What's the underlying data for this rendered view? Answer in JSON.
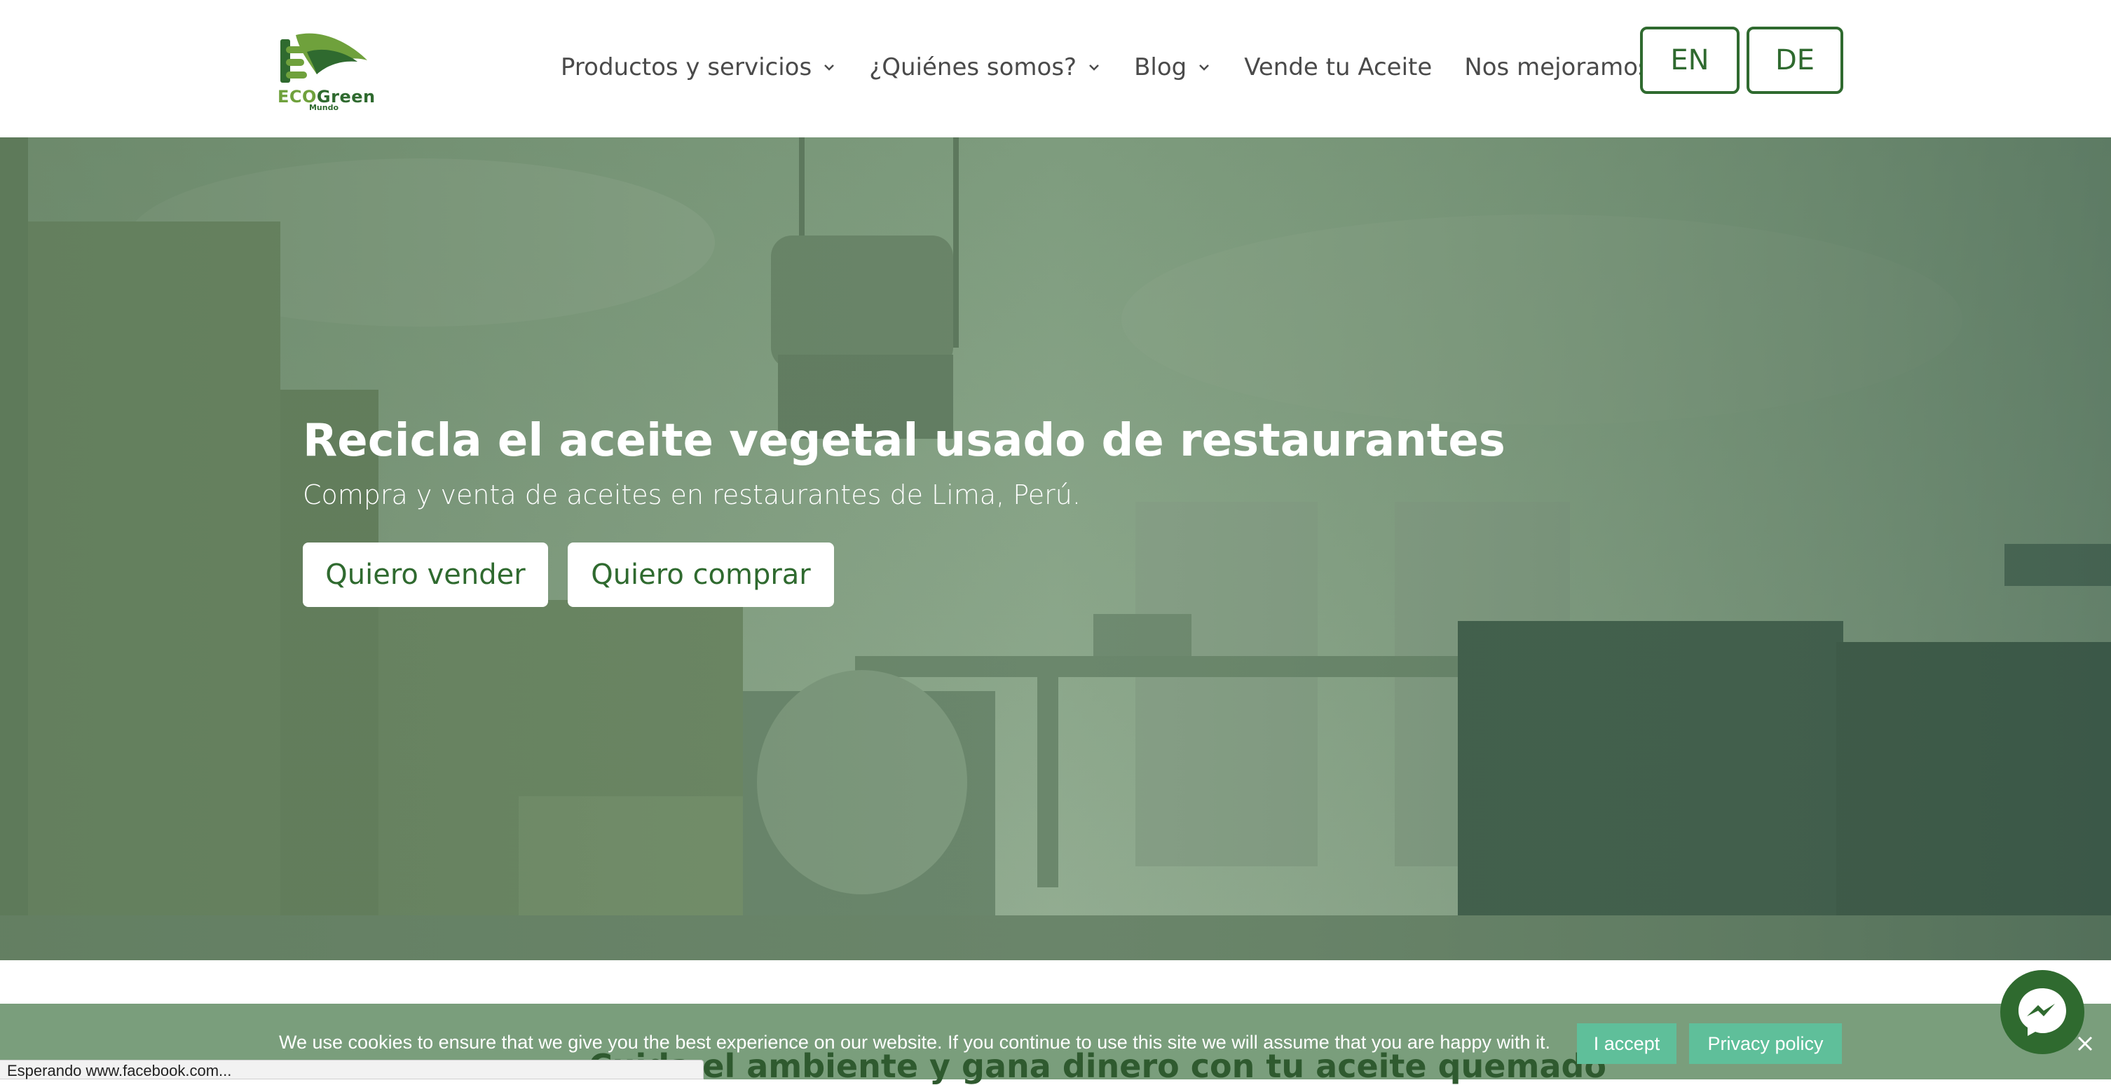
{
  "header": {
    "logo": {
      "eco": "ECO",
      "green": "Green",
      "sub": "Mundo"
    },
    "nav": [
      {
        "label": "Productos y servicios",
        "has_dropdown": true
      },
      {
        "label": "¿Quiénes somos?",
        "has_dropdown": true
      },
      {
        "label": "Blog",
        "has_dropdown": true
      },
      {
        "label": "Vende tu Aceite",
        "has_dropdown": false
      },
      {
        "label": "Nos mejoramos",
        "has_dropdown": false
      }
    ],
    "languages": [
      "EN",
      "DE"
    ]
  },
  "hero": {
    "title": "Recicla el aceite vegetal usado de restaurantes",
    "subtitle": "Compra y venta de aceites en restaurantes de Lima, Perú.",
    "buttons": {
      "sell": "Quiero vender",
      "buy": "Quiero comprar"
    }
  },
  "section": {
    "heading": "Cuida el ambiente y gana dinero con tu aceite quemado"
  },
  "cookie": {
    "text": "We use cookies to ensure that we give you the best experience on our website. If you continue to use this site we will assume that you are happy with it.",
    "accept": "I accept",
    "policy": "Privacy policy"
  },
  "status_bar": {
    "text": "Esperando www.facebook.com..."
  },
  "icons": {
    "chevron": "chevron-down-icon",
    "messenger": "messenger-icon",
    "close": "close-icon"
  },
  "colors": {
    "brand_dark_green": "#2f6a2f",
    "brand_light_green": "#6fa13c",
    "hero_overlay": "#6f8c6f",
    "cookie_button": "#5fbf9a"
  }
}
